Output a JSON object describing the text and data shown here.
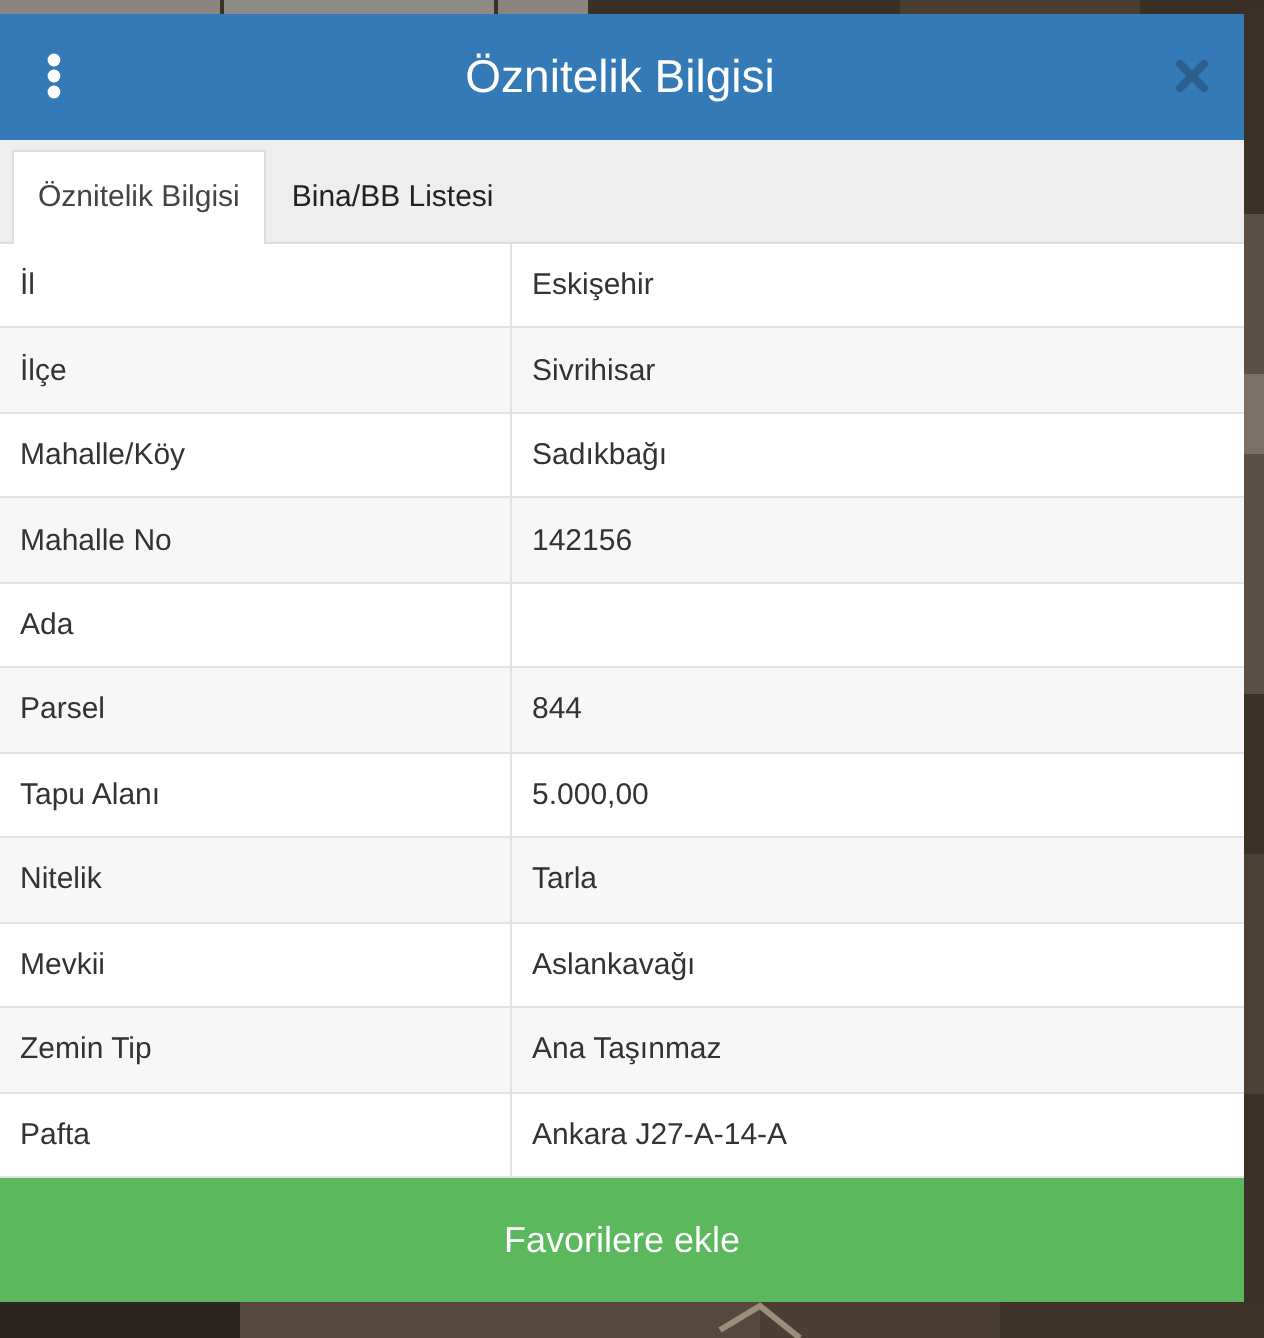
{
  "dialog": {
    "title": "Öznitelik Bilgisi"
  },
  "tabs": [
    {
      "label": "Öznitelik Bilgisi",
      "selected": true
    },
    {
      "label": "Bina/BB Listesi",
      "selected": false
    }
  ],
  "table": {
    "rows": [
      {
        "name": "İl",
        "value": "Eskişehir"
      },
      {
        "name": "İlçe",
        "value": "Sivrihisar"
      },
      {
        "name": "Mahalle/Köy",
        "value": "Sadıkbağı"
      },
      {
        "name": "Mahalle No",
        "value": "142156"
      },
      {
        "name": "Ada",
        "value": ""
      },
      {
        "name": "Parsel",
        "value": "844"
      },
      {
        "name": "Tapu Alanı",
        "value": "5.000,00"
      },
      {
        "name": "Nitelik",
        "value": "Tarla"
      },
      {
        "name": "Mevkii",
        "value": "Aslankavağı"
      },
      {
        "name": "Zemin Tip",
        "value": "Ana Taşınmaz"
      },
      {
        "name": "Pafta",
        "value": "Ankara J27-A-14-A"
      }
    ]
  },
  "action_button": "Favorilere ekle"
}
